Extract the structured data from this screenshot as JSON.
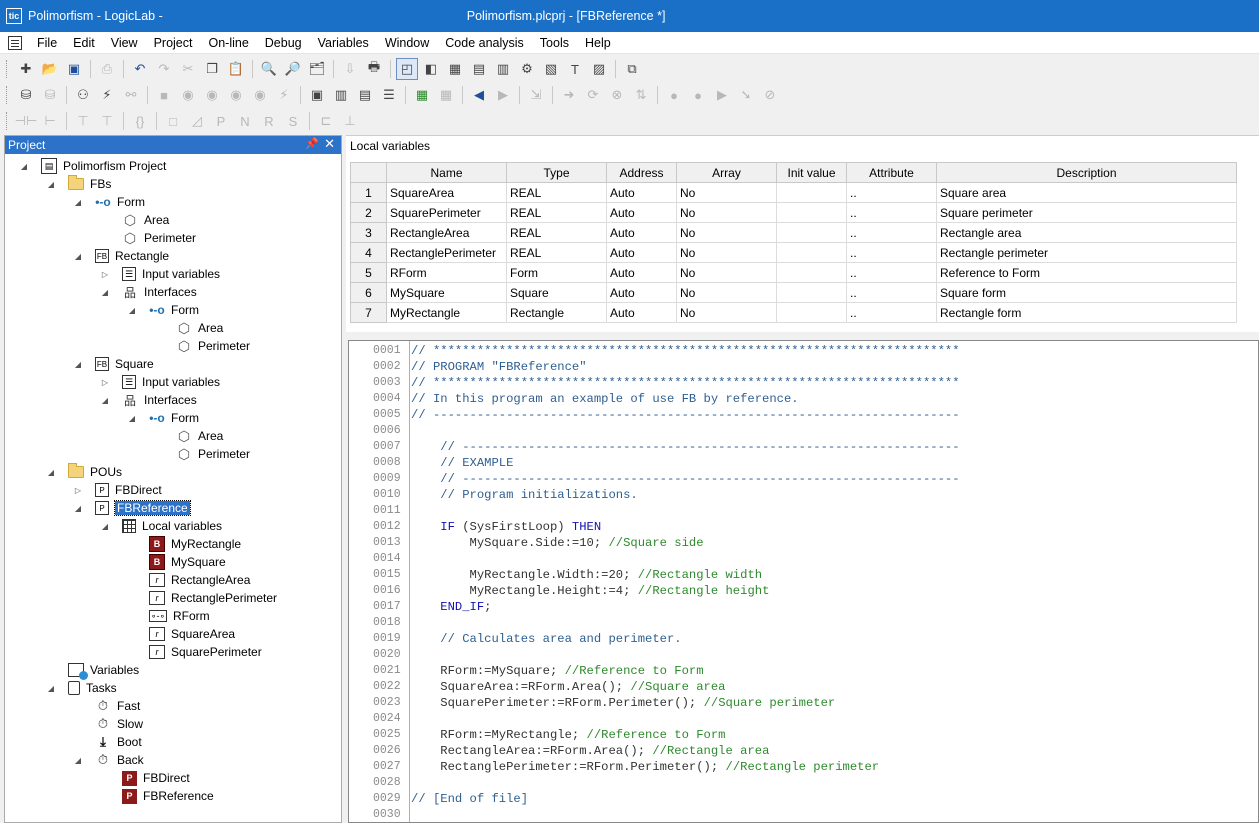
{
  "window": {
    "title_prefix": "Polimorfism - LogicLab -",
    "title_suffix": "Polimorfism.plcprj - [FBReference *]",
    "app_icon": "tic-tac-icon"
  },
  "menu": [
    "File",
    "Edit",
    "View",
    "Project",
    "On-line",
    "Debug",
    "Variables",
    "Window",
    "Code analysis",
    "Tools",
    "Help"
  ],
  "project_panel": {
    "title": "Project",
    "tree": [
      {
        "label": "Polimorfism Project",
        "icon": "project-icon",
        "indent": 0,
        "toggle": "expanded"
      },
      {
        "label": "FBs",
        "icon": "folder-icon",
        "indent": 1,
        "toggle": "expanded"
      },
      {
        "label": "Form",
        "icon": "interface-icon",
        "indent": 2,
        "toggle": "expanded"
      },
      {
        "label": "Area",
        "icon": "method-icon",
        "indent": 3,
        "toggle": ""
      },
      {
        "label": "Perimeter",
        "icon": "method-icon",
        "indent": 3,
        "toggle": ""
      },
      {
        "label": "Rectangle",
        "icon": "function-block-icon",
        "indent": 2,
        "toggle": "expanded"
      },
      {
        "label": "Input variables",
        "icon": "variables-list-icon",
        "indent": 3,
        "toggle": "collapsed"
      },
      {
        "label": "Interfaces",
        "icon": "hierarchy-icon",
        "indent": 3,
        "toggle": "expanded"
      },
      {
        "label": "Form",
        "icon": "interface-icon",
        "indent": 4,
        "toggle": "expanded"
      },
      {
        "label": "Area",
        "icon": "method-icon",
        "indent": 5,
        "toggle": ""
      },
      {
        "label": "Perimeter",
        "icon": "method-icon",
        "indent": 5,
        "toggle": ""
      },
      {
        "label": "Square",
        "icon": "function-block-icon",
        "indent": 2,
        "toggle": "expanded"
      },
      {
        "label": "Input variables",
        "icon": "variables-list-icon",
        "indent": 3,
        "toggle": "collapsed"
      },
      {
        "label": "Interfaces",
        "icon": "hierarchy-icon",
        "indent": 3,
        "toggle": "expanded"
      },
      {
        "label": "Form",
        "icon": "interface-icon",
        "indent": 4,
        "toggle": "expanded"
      },
      {
        "label": "Area",
        "icon": "method-icon",
        "indent": 5,
        "toggle": ""
      },
      {
        "label": "Perimeter",
        "icon": "method-icon",
        "indent": 5,
        "toggle": ""
      },
      {
        "label": "POUs",
        "icon": "folder-icon",
        "indent": 1,
        "toggle": "expanded"
      },
      {
        "label": "FBDirect",
        "icon": "program-icon",
        "indent": 2,
        "toggle": "collapsed"
      },
      {
        "label": "FBReference",
        "icon": "program-icon",
        "indent": 2,
        "toggle": "expanded",
        "selected": true
      },
      {
        "label": "Local variables",
        "icon": "grid-icon",
        "indent": 3,
        "toggle": "expanded"
      },
      {
        "label": "MyRectangle",
        "icon": "fb-instance-icon",
        "indent": 4,
        "toggle": ""
      },
      {
        "label": "MySquare",
        "icon": "fb-instance-icon",
        "indent": 4,
        "toggle": ""
      },
      {
        "label": "RectangleArea",
        "icon": "real-variable-icon",
        "indent": 4,
        "toggle": ""
      },
      {
        "label": "RectanglePerimeter",
        "icon": "real-variable-icon",
        "indent": 4,
        "toggle": ""
      },
      {
        "label": "RForm",
        "icon": "reference-icon",
        "indent": 4,
        "toggle": ""
      },
      {
        "label": "SquareArea",
        "icon": "real-variable-icon",
        "indent": 4,
        "toggle": ""
      },
      {
        "label": "SquarePerimeter",
        "icon": "real-variable-icon",
        "indent": 4,
        "toggle": ""
      },
      {
        "label": "Variables",
        "icon": "global-variables-icon",
        "indent": 1,
        "toggle": ""
      },
      {
        "label": "Tasks",
        "icon": "tasks-icon",
        "indent": 1,
        "toggle": "expanded"
      },
      {
        "label": "Fast",
        "icon": "stopwatch-icon",
        "indent": 2,
        "toggle": ""
      },
      {
        "label": "Slow",
        "icon": "stopwatch-icon",
        "indent": 2,
        "toggle": ""
      },
      {
        "label": "Boot",
        "icon": "boot-arrow-icon",
        "indent": 2,
        "toggle": ""
      },
      {
        "label": "Back",
        "icon": "stopwatch-icon",
        "indent": 2,
        "toggle": "expanded"
      },
      {
        "label": "FBDirect",
        "icon": "program-task-icon",
        "indent": 3,
        "toggle": ""
      },
      {
        "label": "FBReference",
        "icon": "program-task-icon",
        "indent": 3,
        "toggle": ""
      }
    ]
  },
  "local_variables": {
    "title": "Local variables",
    "columns": [
      "Name",
      "Type",
      "Address",
      "Array",
      "Init value",
      "Attribute",
      "Description"
    ],
    "rows": [
      {
        "num": "1",
        "name": "SquareArea",
        "type": "REAL",
        "address": "Auto",
        "array": "No",
        "init": "",
        "attribute": "..",
        "description": "Square area"
      },
      {
        "num": "2",
        "name": "SquarePerimeter",
        "type": "REAL",
        "address": "Auto",
        "array": "No",
        "init": "",
        "attribute": "..",
        "description": "Square perimeter"
      },
      {
        "num": "3",
        "name": "RectangleArea",
        "type": "REAL",
        "address": "Auto",
        "array": "No",
        "init": "",
        "attribute": "..",
        "description": "Rectangle area"
      },
      {
        "num": "4",
        "name": "RectanglePerimeter",
        "type": "REAL",
        "address": "Auto",
        "array": "No",
        "init": "",
        "attribute": "..",
        "description": "Rectangle perimeter"
      },
      {
        "num": "5",
        "name": "RForm",
        "type": "Form",
        "address": "Auto",
        "array": "No",
        "init": "",
        "attribute": "..",
        "description": "Reference to Form"
      },
      {
        "num": "6",
        "name": "MySquare",
        "type": "Square",
        "address": "Auto",
        "array": "No",
        "init": "",
        "attribute": "..",
        "description": "Square form"
      },
      {
        "num": "7",
        "name": "MyRectangle",
        "type": "Rectangle",
        "address": "Auto",
        "array": "No",
        "init": "",
        "attribute": "..",
        "description": "Rectangle form"
      }
    ]
  },
  "editor": {
    "lines": [
      {
        "num": "0001",
        "segments": [
          {
            "t": "// ************************************************************************",
            "c": "c-comment"
          }
        ]
      },
      {
        "num": "0002",
        "segments": [
          {
            "t": "// PROGRAM \"FBReference\"",
            "c": "c-comment"
          }
        ]
      },
      {
        "num": "0003",
        "segments": [
          {
            "t": "// ************************************************************************",
            "c": "c-comment"
          }
        ]
      },
      {
        "num": "0004",
        "segments": [
          {
            "t": "// In this program an example of use FB by reference.",
            "c": "c-comment"
          }
        ]
      },
      {
        "num": "0005",
        "segments": [
          {
            "t": "// ------------------------------------------------------------------------",
            "c": "c-comment"
          }
        ]
      },
      {
        "num": "0006",
        "segments": []
      },
      {
        "num": "0007",
        "segments": [
          {
            "t": "    // --------------------------------------------------------------------",
            "c": "c-comment"
          }
        ]
      },
      {
        "num": "0008",
        "segments": [
          {
            "t": "    // EXAMPLE",
            "c": "c-comment"
          }
        ]
      },
      {
        "num": "0009",
        "segments": [
          {
            "t": "    // --------------------------------------------------------------------",
            "c": "c-comment"
          }
        ]
      },
      {
        "num": "0010",
        "segments": [
          {
            "t": "    // Program initializations.",
            "c": "c-comment"
          }
        ]
      },
      {
        "num": "0011",
        "segments": []
      },
      {
        "num": "0012",
        "segments": [
          {
            "t": "    IF",
            "c": "c-kw"
          },
          {
            "t": " (SysFirstLoop) ",
            "c": "c-code"
          },
          {
            "t": "THEN",
            "c": "c-kw"
          }
        ]
      },
      {
        "num": "0013",
        "segments": [
          {
            "t": "        MySquare.Side:=10; ",
            "c": "c-code"
          },
          {
            "t": "//Square side",
            "c": "c-green"
          }
        ]
      },
      {
        "num": "0014",
        "segments": []
      },
      {
        "num": "0015",
        "segments": [
          {
            "t": "        MyRectangle.Width:=20; ",
            "c": "c-code"
          },
          {
            "t": "//Rectangle width",
            "c": "c-green"
          }
        ]
      },
      {
        "num": "0016",
        "segments": [
          {
            "t": "        MyRectangle.Height:=4; ",
            "c": "c-code"
          },
          {
            "t": "//Rectangle height",
            "c": "c-green"
          }
        ]
      },
      {
        "num": "0017",
        "segments": [
          {
            "t": "    END_IF",
            "c": "c-kw"
          },
          {
            "t": ";",
            "c": "c-code"
          }
        ]
      },
      {
        "num": "0018",
        "segments": []
      },
      {
        "num": "0019",
        "segments": [
          {
            "t": "    // Calculates area and perimeter.",
            "c": "c-comment"
          }
        ]
      },
      {
        "num": "0020",
        "segments": []
      },
      {
        "num": "0021",
        "segments": [
          {
            "t": "    RForm:=MySquare; ",
            "c": "c-code"
          },
          {
            "t": "//Reference to Form",
            "c": "c-green"
          }
        ]
      },
      {
        "num": "0022",
        "segments": [
          {
            "t": "    SquareArea:=RForm.Area(); ",
            "c": "c-code"
          },
          {
            "t": "//Square area",
            "c": "c-green"
          }
        ]
      },
      {
        "num": "0023",
        "segments": [
          {
            "t": "    SquarePerimeter:=RForm.Perimeter(); ",
            "c": "c-code"
          },
          {
            "t": "//Square perimeter",
            "c": "c-green"
          }
        ]
      },
      {
        "num": "0024",
        "segments": []
      },
      {
        "num": "0025",
        "segments": [
          {
            "t": "    RForm:=MyRectangle; ",
            "c": "c-code"
          },
          {
            "t": "//Reference to Form",
            "c": "c-green"
          }
        ]
      },
      {
        "num": "0026",
        "segments": [
          {
            "t": "    RectangleArea:=RForm.Area(); ",
            "c": "c-code"
          },
          {
            "t": "//Rectangle area",
            "c": "c-green"
          }
        ]
      },
      {
        "num": "0027",
        "segments": [
          {
            "t": "    RectanglePerimeter:=RForm.Perimeter(); ",
            "c": "c-code"
          },
          {
            "t": "//Rectangle perimeter",
            "c": "c-green"
          }
        ]
      },
      {
        "num": "0028",
        "segments": []
      },
      {
        "num": "0029",
        "segments": [
          {
            "t": "// [End of file]",
            "c": "c-comment"
          }
        ]
      },
      {
        "num": "0030",
        "segments": []
      }
    ]
  },
  "colors": {
    "titlebar": "#1a6fc6",
    "selection": "#2b72c8",
    "comment": "#2e5f92",
    "keyword": "#1414b4",
    "inline_comment": "#2e8a2e"
  }
}
